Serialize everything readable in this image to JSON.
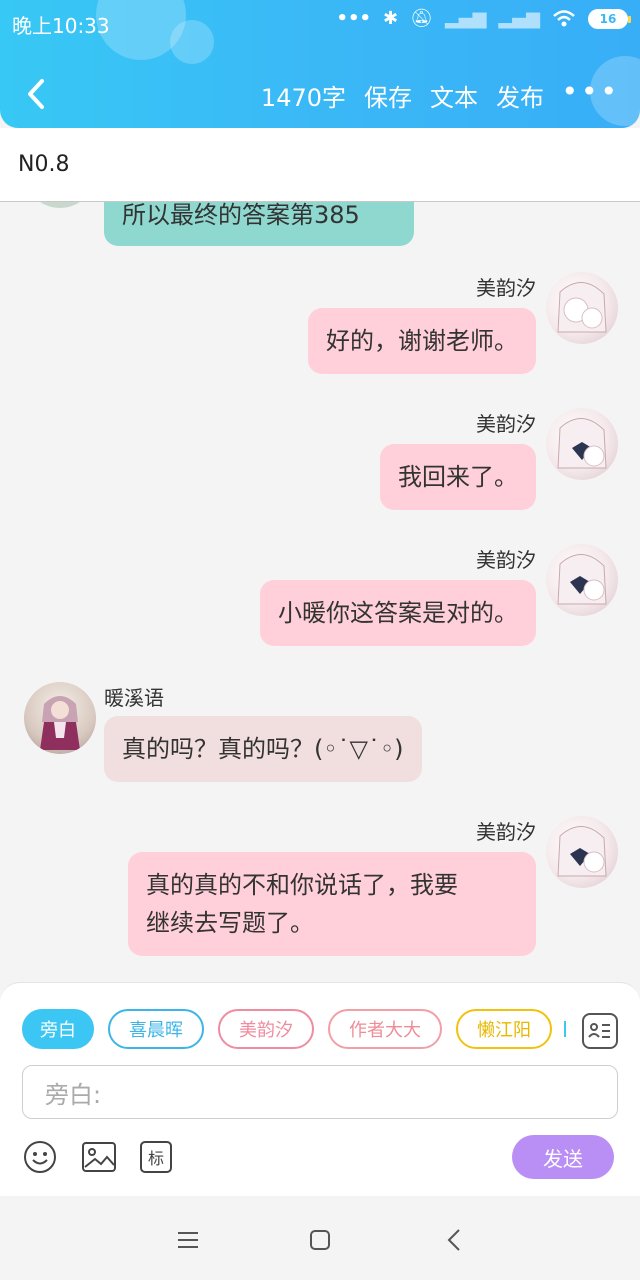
{
  "status_bar": {
    "time": "晚上10:33",
    "battery": "16"
  },
  "header": {
    "word_count": "1470字",
    "save_label": "保存",
    "text_label": "文本",
    "publish_label": "发布",
    "more_label": "•••"
  },
  "subbar": {
    "title": "N0.8"
  },
  "messages": [
    {
      "text": "所以最终的答案第385"
    },
    {
      "sender": "美韵汐",
      "text": "好的，谢谢老师。"
    },
    {
      "sender": "美韵汐",
      "text": "我回来了。"
    },
    {
      "sender": "美韵汐",
      "text": "小暖你这答案是对的。"
    },
    {
      "sender": "暖溪语",
      "text": "真的吗？真的吗？(◦˙▽˙◦)"
    },
    {
      "sender": "美韵汐",
      "text_line1": "真的真的不和你说话了，我要",
      "text_line2": "继续去写题了。"
    }
  ],
  "chips": [
    "旁白",
    "喜晨晖",
    "美韵汐",
    "作者大大",
    "懒江阳"
  ],
  "input": {
    "placeholder": "旁白:"
  },
  "tools": {
    "mark_label": "标"
  },
  "send_label": "发送",
  "colors": {
    "header": "#38b8f6",
    "pink_bubble": "#ffd0da",
    "teal_bubble": "#8fd8cf",
    "send": "#b98ef5"
  }
}
